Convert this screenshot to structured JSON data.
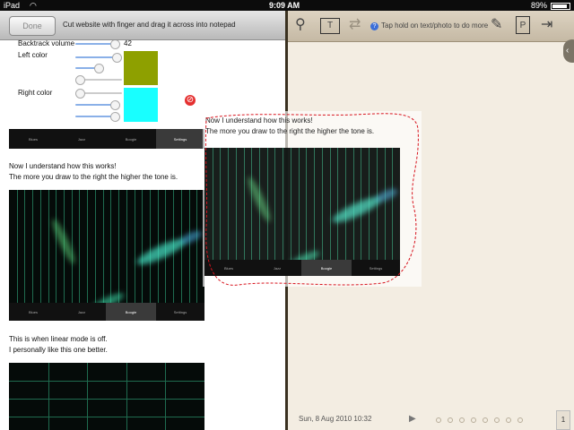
{
  "status_bar": {
    "device": "iPad",
    "time": "9:09 AM",
    "battery": "89%"
  },
  "left_toolbar": {
    "done_label": "Done",
    "hint": "Cut website with finger and drag it across into notepad"
  },
  "settings_screenshot": {
    "backtrack_label": "Backtrack volume",
    "backtrack_value": "42",
    "left_color_label": "Left color",
    "right_color_label": "Right color",
    "left_color": "#8ea000",
    "right_color": "#18ffff"
  },
  "app_tabs": [
    "Blues",
    "Jazz",
    "Boogie",
    "Settings"
  ],
  "article": {
    "para1_line1": "Now I understand how this works!",
    "para1_line2": "The more you draw to the right the higher the tone is.",
    "para2_line1": "This is when linear mode is off.",
    "para2_line2": "I personally like this one better."
  },
  "right_toolbar": {
    "hint": "Tap hold on text/photo to do more",
    "text_tool_label": "T"
  },
  "clipping": {
    "line1": "Now I understand how this works!",
    "line2": "The more you draw to the right the higher the tone is."
  },
  "notepad": {
    "date": "Sun, 8 Aug 2010 10:32",
    "page_number": "1",
    "page_dots": 8
  },
  "icons": [
    "wifi-icon",
    "battery-icon",
    "search-icon",
    "text-box-icon",
    "redo-icon",
    "info-icon",
    "settings-icon",
    "export-icon",
    "exit-icon",
    "no-entry-icon",
    "tag-icon",
    "side-arrow-icon"
  ],
  "colors": {
    "accent": "#3b6ed8",
    "clip_border": "#d8141e",
    "paper": "#f3ede2"
  }
}
